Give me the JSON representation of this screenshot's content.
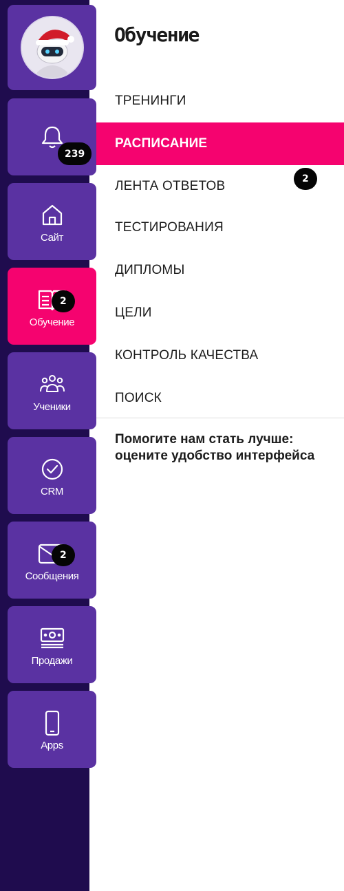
{
  "sidebar": {
    "notifications": {
      "badge": "239"
    },
    "items": [
      {
        "label": "Сайт",
        "icon": "home-icon"
      },
      {
        "label": "Обучение",
        "icon": "book-icon",
        "badge": "2",
        "active": true
      },
      {
        "label": "Ученики",
        "icon": "users-icon"
      },
      {
        "label": "CRM",
        "icon": "check-circle-icon"
      },
      {
        "label": "Сообщения",
        "icon": "envelope-icon",
        "badge": "2"
      },
      {
        "label": "Продажи",
        "icon": "money-icon"
      },
      {
        "label": "Apps",
        "icon": "phone-icon"
      }
    ]
  },
  "panel": {
    "title": "Обучение",
    "menu": [
      {
        "label": "ТРЕНИНГИ"
      },
      {
        "label": "РАСПИСАНИЕ",
        "active": true
      },
      {
        "label": "ЛЕНТА ОТВЕТОВ",
        "badge": "2"
      },
      {
        "label": "ТЕСТИРОВАНИЯ"
      },
      {
        "label": "ДИПЛОМЫ"
      },
      {
        "label": "ЦЕЛИ"
      },
      {
        "label": "КОНТРОЛЬ КАЧЕСТВА"
      },
      {
        "label": "ПОИСК"
      }
    ],
    "feedback": "Помогите нам стать лучше: оцените удобство интерфейса"
  },
  "colors": {
    "rail": "#1f0c4e",
    "tile": "#5a32a2",
    "accent": "#f5036f",
    "badge": "#050505"
  }
}
